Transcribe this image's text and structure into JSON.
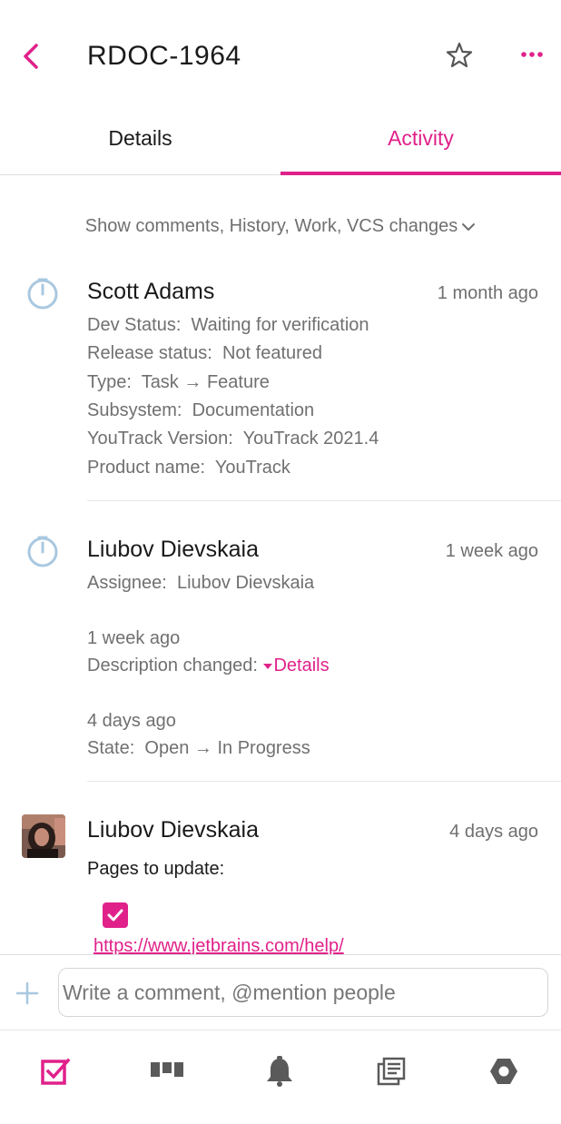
{
  "header": {
    "issue_id": "RDOC-1964",
    "icons": [
      "chevron-left-icon",
      "star-outline-icon",
      "more-dots-icon"
    ]
  },
  "tabs": [
    {
      "label": "Details",
      "active": false
    },
    {
      "label": "Activity",
      "active": true
    }
  ],
  "filter": {
    "label": "Show comments, History, Work, VCS changes",
    "icon": "chevron-down-icon"
  },
  "activity": [
    {
      "author": "Scott Adams",
      "time_ago": "1 month ago",
      "icon": "history-icon",
      "changes": [
        {
          "field": "Dev Status:",
          "value": "Waiting for verification"
        },
        {
          "field": "Release status:",
          "value": "Not featured"
        },
        {
          "field": "Type:",
          "from": "Task",
          "arrow": "→",
          "to": "Feature"
        },
        {
          "field": "Subsystem:",
          "value": "Documentation"
        },
        {
          "field": "YouTrack Version:",
          "value": "YouTrack 2021.4"
        },
        {
          "field": "Product name:",
          "value": "YouTrack"
        }
      ]
    },
    {
      "author": "Liubov Dievskaia",
      "time_ago": "1 week ago",
      "icon": "history-icon",
      "changes": [
        {
          "field": "Assignee:",
          "value": "Liubov Dievskaia"
        }
      ],
      "subentries": [
        {
          "time_ago": "1 week ago",
          "field": "Description changed:",
          "link": "Details"
        },
        {
          "time_ago": "4 days ago",
          "field": "State:",
          "from": "Open",
          "arrow": "→",
          "to": "In Progress"
        }
      ]
    },
    {
      "author": "Liubov Dievskaia",
      "time_ago": "4 days ago",
      "icon": "avatar",
      "comment": {
        "text": "Pages to update:",
        "checked": true,
        "url": "https://www.jetbrains.com/help/"
      }
    }
  ],
  "composer": {
    "placeholder": "Write a comment, @mention people",
    "value": ""
  },
  "bottom_nav": [
    {
      "icon": "issues-checkbox-icon",
      "active": true
    },
    {
      "icon": "agile-board-icon",
      "active": false
    },
    {
      "icon": "notifications-bell-icon",
      "active": false
    },
    {
      "icon": "knowledge-base-icon",
      "active": false
    },
    {
      "icon": "settings-hexagon-icon",
      "active": false
    }
  ],
  "colors": {
    "accent": "#e0218a",
    "muted_text": "#707070",
    "history_icon": "#a9c8e0",
    "nav_icon": "#5a5a5a"
  }
}
